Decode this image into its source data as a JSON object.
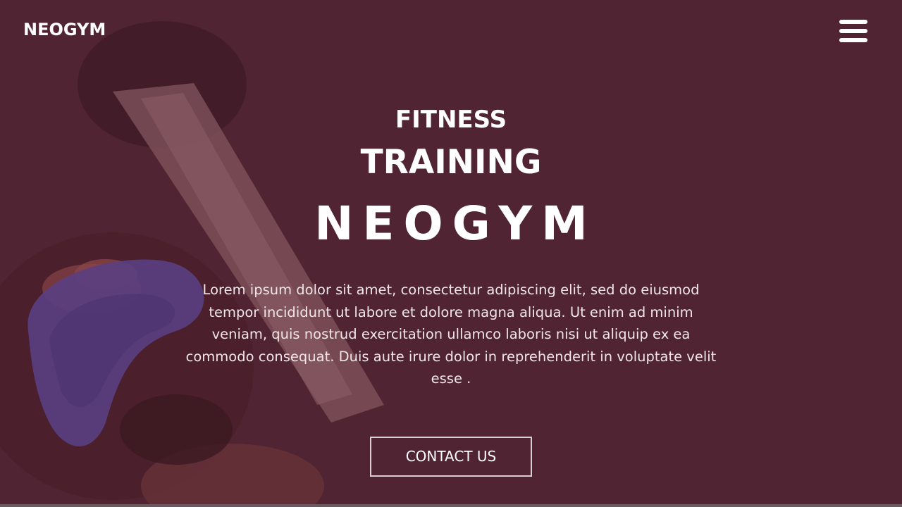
{
  "header": {
    "brand": "NEOGYM",
    "menu_icon": "hamburger-menu-icon"
  },
  "hero": {
    "line1": "FITNESS",
    "line2": "TRAINING",
    "line3": "NEOGYM",
    "description": "Lorem ipsum dolor sit amet, consectetur adipiscing elit, sed do eiusmod tempor incididunt ut labore et dolore magna aliqua. Ut enim ad minim veniam, quis nostrud exercitation ullamco laboris nisi ut aliquip ex ea commodo consequat. Duis aute irure dolor in reprehenderit in voluptate velit esse .",
    "cta_label": "CONTACT US"
  },
  "colors": {
    "overlay": "#512331",
    "text": "#ffffff",
    "button_border": "#d9cdd1"
  }
}
